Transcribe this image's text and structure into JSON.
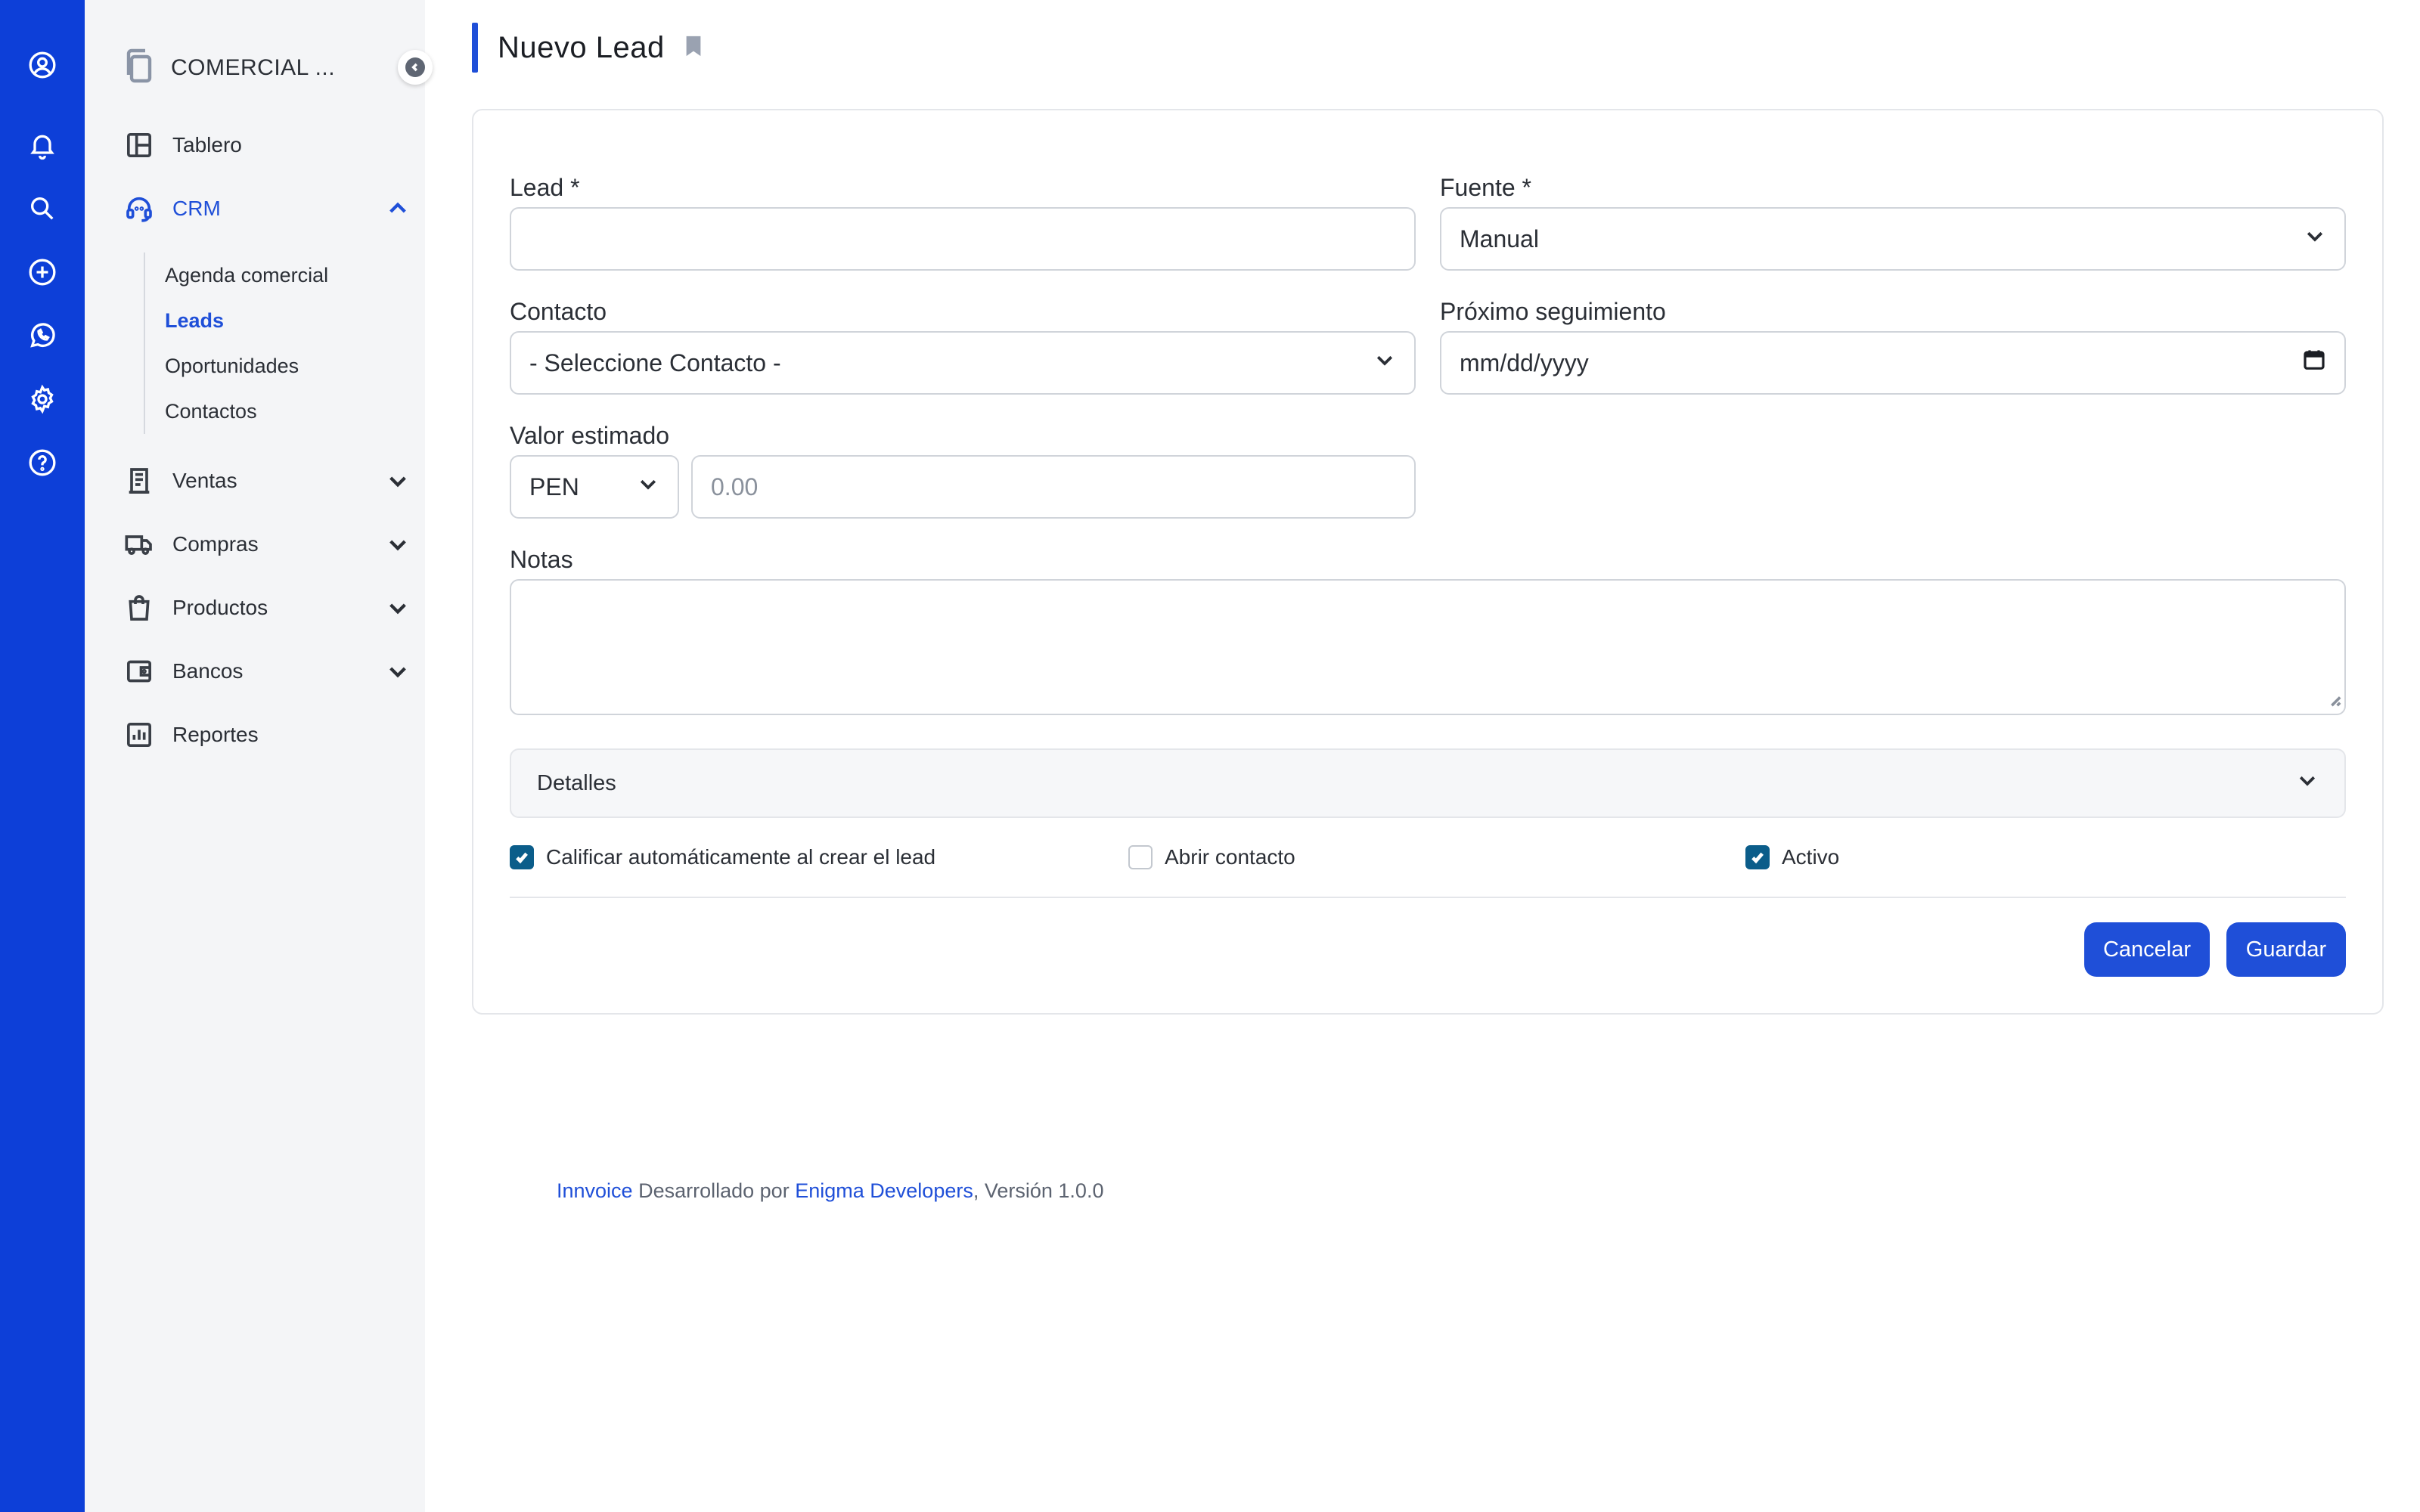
{
  "rail": {
    "icons": [
      "user-circle-icon",
      "bell-icon",
      "search-icon",
      "plus-circle-icon",
      "whatsapp-icon",
      "gear-icon",
      "help-circle-icon"
    ]
  },
  "sidebar": {
    "company": "COMERCIAL ...",
    "nav": {
      "tablero": "Tablero",
      "crm": "CRM",
      "ventas": "Ventas",
      "compras": "Compras",
      "productos": "Productos",
      "bancos": "Bancos",
      "reportes": "Reportes"
    },
    "crm_sub": {
      "agenda": "Agenda comercial",
      "leads": "Leads",
      "oportunidades": "Oportunidades",
      "contactos": "Contactos"
    }
  },
  "page": {
    "title": "Nuevo Lead"
  },
  "form": {
    "lead_label": "Lead *",
    "lead_value": "",
    "fuente_label": "Fuente *",
    "fuente_value": "Manual",
    "contacto_label": "Contacto",
    "contacto_value": "- Seleccione Contacto -",
    "seguimiento_label": "Próximo seguimiento",
    "seguimiento_placeholder": "mm/dd/yyyy",
    "valor_label": "Valor estimado",
    "moneda_value": "PEN",
    "valor_placeholder": "0.00",
    "notas_label": "Notas",
    "detalles_label": "Detalles",
    "check_calificar": "Calificar automáticamente al crear el lead",
    "check_abrir": "Abrir contacto",
    "check_activo": "Activo",
    "cancel_label": "Cancelar",
    "save_label": "Guardar"
  },
  "footer": {
    "brand": "Innvoice",
    "developed_by": "Desarrollado por",
    "company": "Enigma Developers",
    "version": ", Versión 1.0.0"
  },
  "colors": {
    "brand_blue": "#1f4fd8",
    "rail_blue": "#0d3fd8",
    "checkbox": "#0b5d8a"
  }
}
